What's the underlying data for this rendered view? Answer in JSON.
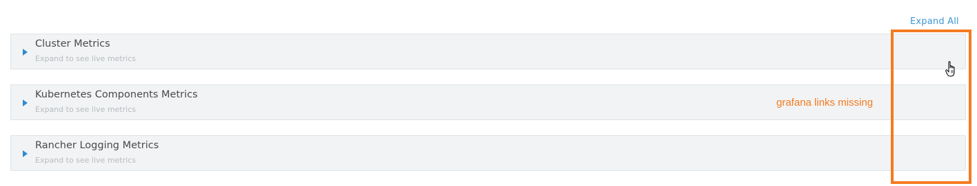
{
  "toolbar": {
    "expand_all_label": "Expand All"
  },
  "panels": [
    {
      "title": "Cluster Metrics",
      "subtitle": "Expand to see live metrics",
      "icon": "caret-right-icon"
    },
    {
      "title": "Kubernetes Components Metrics",
      "subtitle": "Expand to see live metrics",
      "icon": "caret-right-icon"
    },
    {
      "title": "Rancher Logging Metrics",
      "subtitle": "Expand to see live metrics",
      "icon": "caret-right-icon"
    }
  ],
  "annotation": {
    "text": "grafana links missing",
    "color": "#f47b20"
  },
  "colors": {
    "link": "#3d98d3",
    "caret": "#2f8ad0",
    "panel_bg": "#f1f3f4"
  },
  "cursor_icon": "hand-pointer-icon"
}
